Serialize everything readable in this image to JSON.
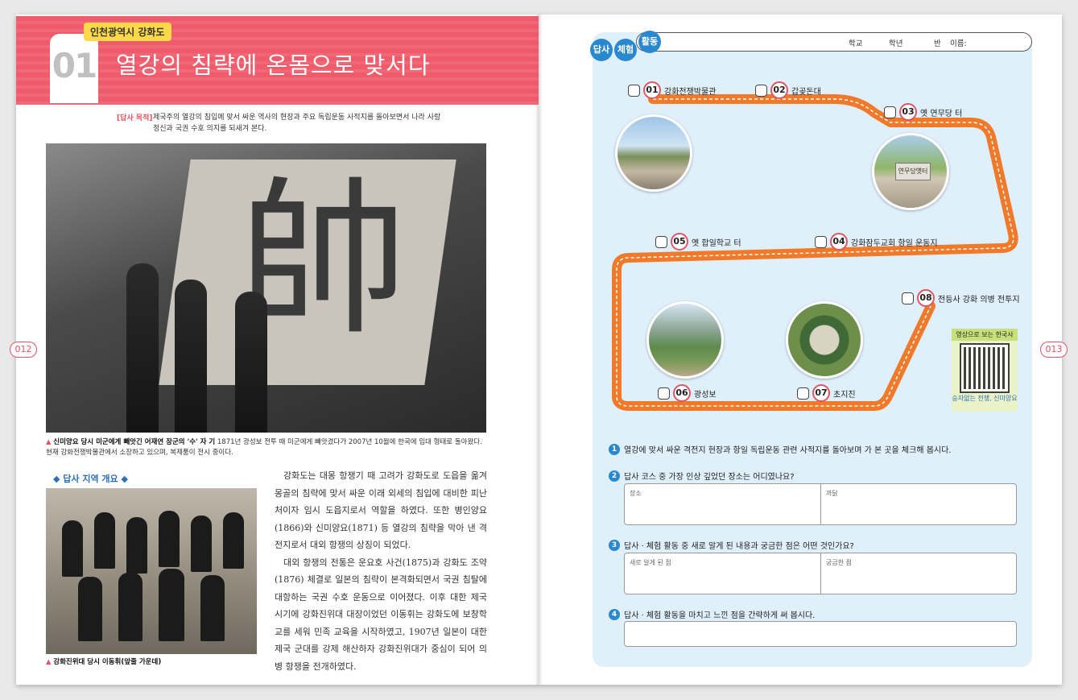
{
  "left": {
    "page_number": "012",
    "region_tag": "인천광역시 강화도",
    "chapter_number": "01",
    "title": "열강의 침략에 온몸으로 맞서다",
    "purpose_label": "[답사 목적]",
    "purpose_text": "제국주의 열강의 침입에 맞서 싸운 역사의 현장과 주요 독립운동 사적지를 돌아보면서 나라 사랑 정신과 국권 수호 의지를 되새겨 본다.",
    "flag_char": "帥",
    "photo_caption_bold": "신미양요 당시 미군에게 빼앗긴 어재연 장군의 '수' 자 기",
    "photo_caption": "1871년 광성보 전투 때 미군에게 빼앗겼다가 2007년 10월에 한국에 임대 형태로 돌아왔다. 현재 강화전쟁박물관에서 소장하고 있으며, 복제품이 전시 중이다.",
    "overview_heading": "◆ 답사 지역 개요 ◆",
    "photo2_caption": "강화진위대 당시 이동휘(앞줄 가운데)",
    "body_p1": "강화도는 대몽 항쟁기 때 고려가 강화도로 도읍을 옮겨 몽골의 침략에 맞서 싸운 이래 외세의 침입에 대비한 피난처이자 임시 도읍지로서 역할을 하였다. 또한 병인양요(1866)와 신미양요(1871) 등 열강의 침략을 막아 낸 격전지로서 대외 항쟁의 상징이 되었다.",
    "body_p2": "대외 항쟁의 전통은 운요호 사건(1875)과 강화도 조약(1876) 체결로 일본의 침략이 본격화되면서 국권 침탈에 대항하는 국권 수호 운동으로 이어졌다. 이후 대한 제국 시기에 강화진위대 대장이었던 이동휘는 강화도에 보창학교를 세워 민족 교육을 시작하였고, 1907년 일본이 대한 제국 군대를 강제 해산하자 강화진위대가 중심이 되어 의병 항쟁을 전개하였다."
  },
  "right": {
    "page_number": "013",
    "badge": [
      "답사",
      "체험",
      "활동"
    ],
    "name_fields": [
      "학교",
      "학년",
      "반",
      "이름:"
    ],
    "stops": [
      {
        "num": "01",
        "label": "강화전쟁박물관"
      },
      {
        "num": "02",
        "label": "갑곶돈대"
      },
      {
        "num": "03",
        "label": "옛 연무당 터"
      },
      {
        "num": "04",
        "label": "강화잠두교회 항일 운동지"
      },
      {
        "num": "05",
        "label": "옛 합일학교 터"
      },
      {
        "num": "06",
        "label": "광성보"
      },
      {
        "num": "07",
        "label": "초지진"
      },
      {
        "num": "08",
        "label": "전등사 강화 의병 전투지"
      }
    ],
    "photo_sign": "연무당옛터",
    "qr_title": "영상으로 보는 한국사",
    "qr_caption": "승자없는 전쟁, 신미양요",
    "questions": [
      {
        "num": "1",
        "text": "열강에 맞서 싸운 격전지 현장과 항일 독립운동 관련 사적지를 돌아보며 가 본 곳을 체크해 봅시다."
      },
      {
        "num": "2",
        "text": "답사 코스 중 가장 인상 깊었던 장소는 어디였나요?",
        "fields": [
          "장소",
          "까닭"
        ]
      },
      {
        "num": "3",
        "text": "답사 · 체험 활동 중 새로 알게 된 내용과 궁금한 점은 어떤 것인가요?",
        "fields": [
          "새로 알게 된 점",
          "궁금한 점"
        ]
      },
      {
        "num": "4",
        "text": "답사 · 체험 활동을 마치고 느낀 점을 간략하게 써 봅시다."
      }
    ],
    "colors": {
      "route": "#f07a2a",
      "accent": "#e05562",
      "panel": "#dff0fb",
      "badge": "#2a88cf"
    }
  }
}
